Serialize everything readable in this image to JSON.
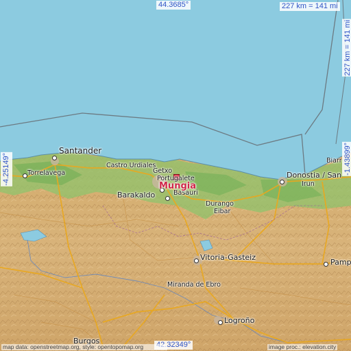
{
  "map": {
    "coords": {
      "top": "44.3685°",
      "bottom": "42.32349°",
      "left": "-4.25149°",
      "right": "-1.43899°"
    },
    "scale": {
      "horizontal": "227 km = 141 mi",
      "vertical": "227 km = 141 mi"
    },
    "target_city": "Mungia",
    "cities": [
      "Santander",
      "Torrelavega",
      "Castro Urdiales",
      "Getxo",
      "Portugalete",
      "Barakaldo",
      "Basauri",
      "Durango",
      "Eibar",
      "Donostia / San Sebastián",
      "Irun",
      "Biarritz",
      "Vitoria-Gasteiz",
      "Miranda de Ebro",
      "Logroño",
      "Burgos",
      "Pamplona"
    ],
    "attribution_left": "map data: openstreetmap.org, style: opentopomap.org",
    "attribution_right": "image proc.: elevation.city",
    "colors": {
      "sea": "#8ccbe0",
      "coord_text": "#2f54c6",
      "target": "#d0284a"
    }
  }
}
